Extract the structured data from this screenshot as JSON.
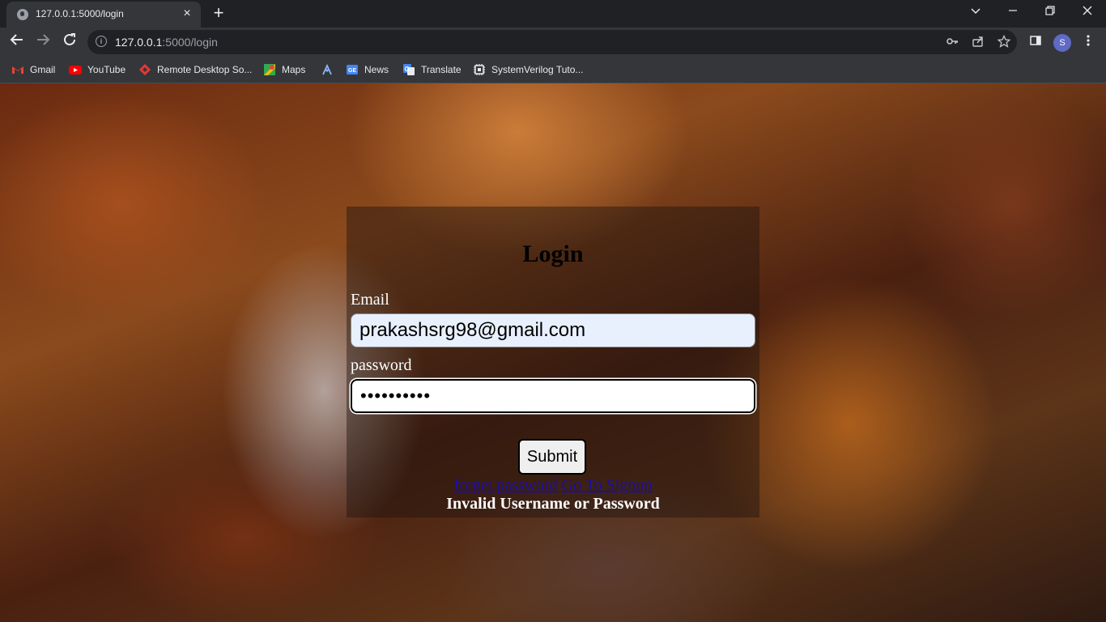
{
  "browser": {
    "tab_title": "127.0.0.1:5000/login",
    "close_glyph": "×",
    "new_tab_glyph": "+",
    "url_host": "127.0.0.1",
    "url_rest": ":5000/login",
    "profile_initial": "S"
  },
  "bookmarks": [
    {
      "label": "Gmail",
      "icon": "gmail-icon",
      "color": "#ea4335"
    },
    {
      "label": "YouTube",
      "icon": "youtube-icon",
      "color": "#ff0000"
    },
    {
      "label": "Remote Desktop So...",
      "icon": "remote-desktop-icon",
      "color": "#e53935"
    },
    {
      "label": "Maps",
      "icon": "maps-icon",
      "color": "#34a853"
    },
    {
      "label": "",
      "icon": "unnamed-bookmark-icon",
      "color": "#8ab4f8"
    },
    {
      "label": "News",
      "icon": "news-icon",
      "color": "#4285f4"
    },
    {
      "label": "Translate",
      "icon": "translate-icon",
      "color": "#4285f4"
    },
    {
      "label": "SystemVerilog Tuto...",
      "icon": "chip-icon",
      "color": "#e8eaed"
    }
  ],
  "login": {
    "title": "Login",
    "email_label": "Email",
    "email_value": "prakashsrg98@gmail.com",
    "password_label": "password",
    "password_value": "••••••••••",
    "submit_label": "Submit",
    "forgot_link": "forget password",
    "signup_link": "Go To Signup",
    "error_message": "Invalid Username or Password"
  }
}
